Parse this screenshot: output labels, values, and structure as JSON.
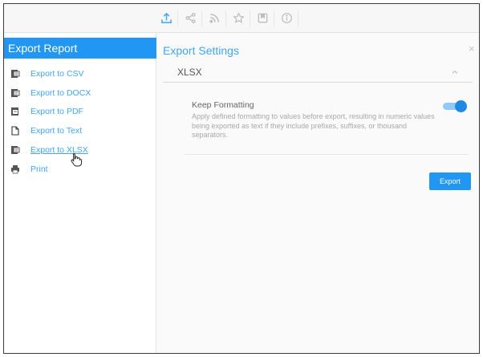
{
  "toolbar": {
    "icons": [
      "export-icon",
      "share-icon",
      "rss-icon",
      "star-icon",
      "bookmark-icon",
      "info-icon"
    ],
    "accent": "#2196f3"
  },
  "sidebar": {
    "title": "Export Report",
    "items": [
      {
        "label": "Export to CSV",
        "icon": "csv-file-icon"
      },
      {
        "label": "Export to DOCX",
        "icon": "docx-file-icon"
      },
      {
        "label": "Export to PDF",
        "icon": "pdf-file-icon"
      },
      {
        "label": "Export to Text",
        "icon": "text-file-icon"
      },
      {
        "label": "Export to XLSX",
        "icon": "xlsx-file-icon",
        "active": true
      },
      {
        "label": "Print",
        "icon": "printer-icon"
      }
    ]
  },
  "panel": {
    "title": "Export Settings",
    "close_label": "×",
    "format": "XLSX",
    "option": {
      "title": "Keep Formatting",
      "description": "Apply defined formatting to values before export, resulting in numeric values being exported as text if they include prefixes, suffixes, or thousand separators.",
      "enabled": true
    },
    "export_label": "Export"
  },
  "colors": {
    "primary": "#2196f3",
    "link": "#42a5f5",
    "toggle_on": "#1e88e5"
  }
}
